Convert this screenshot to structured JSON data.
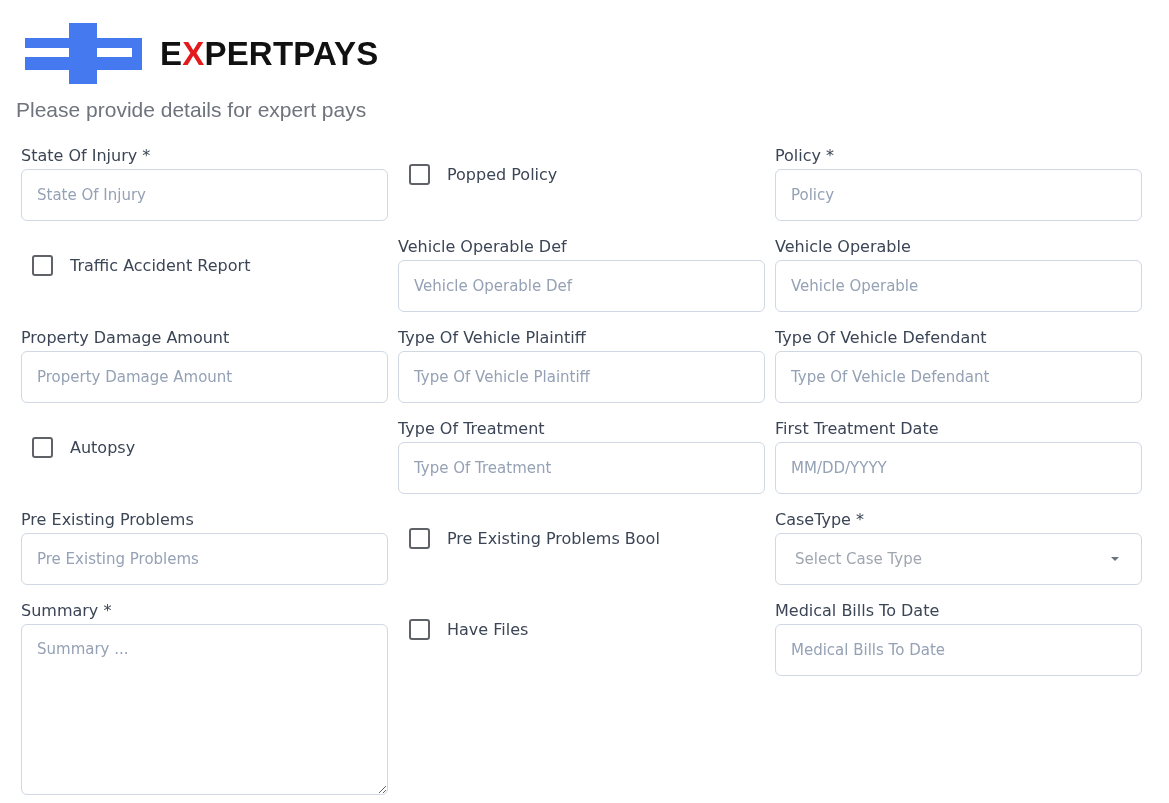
{
  "logo": {
    "parts": [
      {
        "text": "E",
        "accent": false
      },
      {
        "text": "X",
        "accent": true
      },
      {
        "text": "PERTPAYS",
        "accent": false
      }
    ]
  },
  "subtitle": "Please provide details for expert pays",
  "fields": [
    {
      "kind": "input",
      "label": "State Of Injury *",
      "placeholder": "State Of Injury"
    },
    {
      "kind": "checkbox",
      "label": "Popped Policy",
      "checked": false
    },
    {
      "kind": "input",
      "label": "Policy *",
      "placeholder": "Policy"
    },
    {
      "kind": "checkbox",
      "label": "Traffic Accident Report",
      "checked": false
    },
    {
      "kind": "input",
      "label": "Vehicle Operable Def",
      "placeholder": "Vehicle Operable Def"
    },
    {
      "kind": "input",
      "label": "Vehicle Operable",
      "placeholder": "Vehicle Operable"
    },
    {
      "kind": "input",
      "label": "Property Damage Amount",
      "placeholder": "Property Damage Amount"
    },
    {
      "kind": "input",
      "label": "Type Of Vehicle Plaintiff",
      "placeholder": "Type Of Vehicle Plaintiff"
    },
    {
      "kind": "input",
      "label": "Type Of Vehicle Defendant",
      "placeholder": "Type Of Vehicle Defendant"
    },
    {
      "kind": "checkbox",
      "label": "Autopsy",
      "checked": false
    },
    {
      "kind": "input",
      "label": "Type Of Treatment",
      "placeholder": "Type Of Treatment"
    },
    {
      "kind": "input",
      "label": "First Treatment Date",
      "placeholder": "MM/DD/YYYY"
    },
    {
      "kind": "input",
      "label": "Pre Existing Problems",
      "placeholder": "Pre Existing Problems"
    },
    {
      "kind": "checkbox",
      "label": "Pre Existing Problems Bool",
      "checked": false
    },
    {
      "kind": "select",
      "label": "CaseType *",
      "placeholder": "Select Case Type"
    },
    {
      "kind": "textarea",
      "label": "Summary *",
      "placeholder": "Summary ..."
    },
    {
      "kind": "checkbox",
      "label": "Have Files",
      "checked": false
    },
    {
      "kind": "input",
      "label": "Medical Bills To Date",
      "placeholder": "Medical Bills To Date"
    }
  ]
}
